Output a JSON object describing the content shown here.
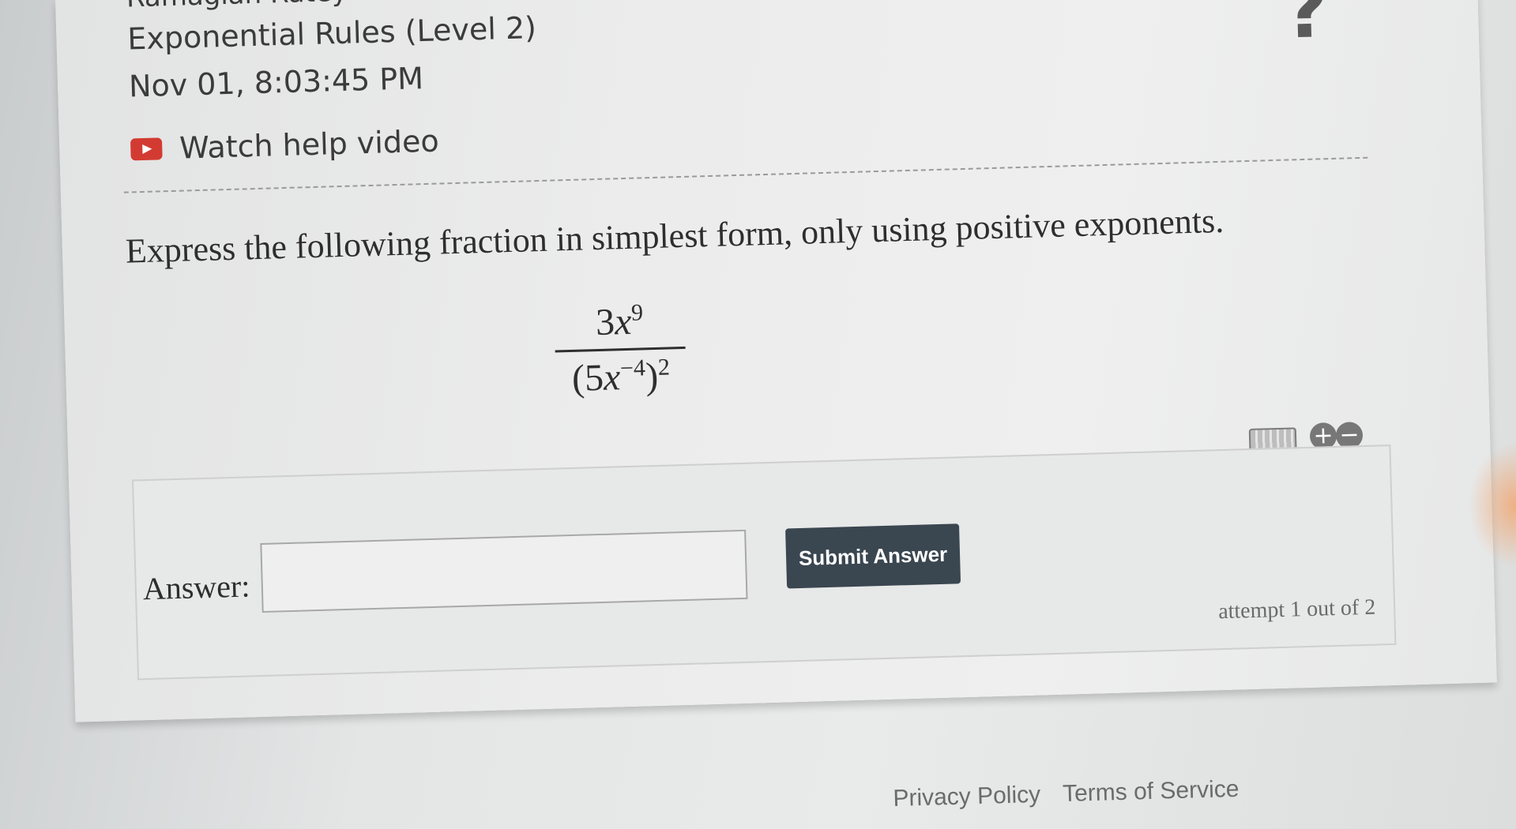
{
  "header": {
    "student_name_cut": "Ramaglan Ratey",
    "assignment_title": "Exponential Rules (Level 2)",
    "datetime": "Nov 01, 8:03:45 PM",
    "help_link_label": "Watch help video",
    "help_icon": "?"
  },
  "question": {
    "prompt": "Express the following fraction in simplest form, only using positive exponents.",
    "numerator": {
      "coef": "3",
      "var": "x",
      "exp": "9"
    },
    "denominator": {
      "open": "(",
      "coef": "5",
      "var": "x",
      "inner_exp": "−4",
      "close": ")",
      "outer_exp": "2"
    }
  },
  "answer": {
    "label": "Answer:",
    "input_value": "",
    "input_placeholder": "",
    "submit_label": "Submit Answer",
    "attempt_text": "attempt 1 out of 2"
  },
  "toolbar_icons": [
    "keyboard-icon",
    "plus-icon",
    "minus-icon"
  ],
  "footer": {
    "privacy": "Privacy Policy",
    "terms": "Terms of Service"
  },
  "colors": {
    "submit_bg": "#3a4650",
    "youtube_red": "#d33b32"
  }
}
